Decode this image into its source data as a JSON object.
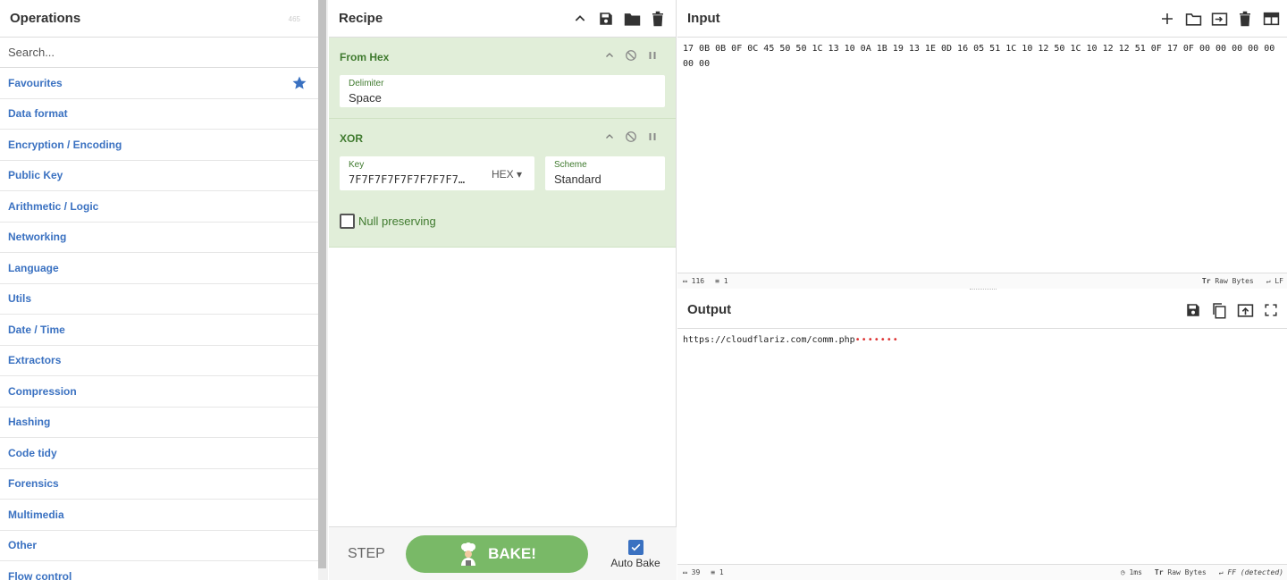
{
  "operations": {
    "title": "Operations",
    "count": "465",
    "search_placeholder": "Search...",
    "categories": [
      "Favourites",
      "Data format",
      "Encryption / Encoding",
      "Public Key",
      "Arithmetic / Logic",
      "Networking",
      "Language",
      "Utils",
      "Date / Time",
      "Extractors",
      "Compression",
      "Hashing",
      "Code tidy",
      "Forensics",
      "Multimedia",
      "Other",
      "Flow control"
    ]
  },
  "recipe": {
    "title": "Recipe",
    "ops": [
      {
        "name": "From Hex",
        "delimiter_label": "Delimiter",
        "delimiter_value": "Space"
      },
      {
        "name": "XOR",
        "key_label": "Key",
        "key_value": "7F7F7F7F7F7F7F7F7…",
        "key_format": "HEX ▾",
        "scheme_label": "Scheme",
        "scheme_value": "Standard",
        "null_label": "Null preserving"
      }
    ],
    "step_label": "STEP",
    "bake_label": "BAKE!",
    "autobake_label": "Auto Bake"
  },
  "input": {
    "title": "Input",
    "text": "17 0B 0B 0F 0C 45 50 50 1C 13 10 0A 1B 19 13 1E 0D 16 05 51 1C 10 12 50 1C 10 12 12 51 0F 17 0F 00 00 00 00 00 00 00",
    "length": "116",
    "lines": "1",
    "charset": "Raw Bytes",
    "eol": "LF"
  },
  "output": {
    "title": "Output",
    "text": "https://cloudflariz.com/comm.php",
    "nulls": "•••••••",
    "length": "39",
    "lines": "1",
    "time": "1ms",
    "charset": "Raw Bytes",
    "eol": "FF (detected)"
  },
  "colors": {
    "accent": "#3a71c1",
    "op_bg": "#e1eed9",
    "op_text": "#3f7a2e",
    "bake": "#79b967"
  }
}
